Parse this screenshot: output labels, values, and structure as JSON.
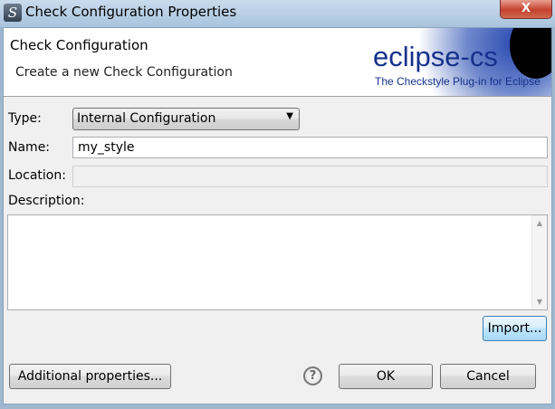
{
  "window": {
    "title": "Check Configuration Properties",
    "close_label": "X"
  },
  "header": {
    "title": "Check Configuration",
    "subtitle": "Create a new Check Configuration",
    "logo_text": "eclipse-cs",
    "logo_tagline": "The Checkstyle Plug-in for Eclipse"
  },
  "form": {
    "type_label": "Type:",
    "type_value": "Internal Configuration",
    "name_label": "Name:",
    "name_value": "my_style",
    "location_label": "Location:",
    "location_value": "",
    "description_label": "Description:",
    "description_value": ""
  },
  "buttons": {
    "import": "Import...",
    "additional": "Additional properties...",
    "help": "?",
    "ok": "OK",
    "cancel": "Cancel"
  }
}
